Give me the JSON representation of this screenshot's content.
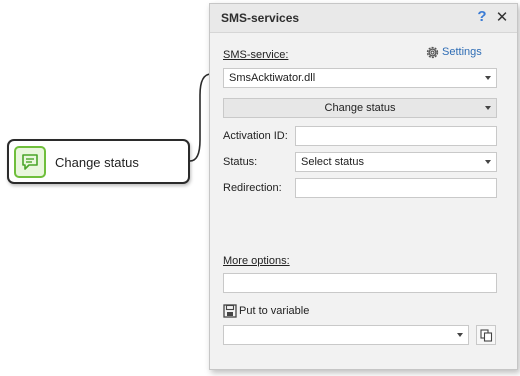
{
  "node": {
    "label": "Change status",
    "icon": "sms-message-icon",
    "accent": "#6fbf3b"
  },
  "dialog": {
    "title": "SMS-services",
    "help_icon": "question-icon",
    "help_glyph": "?",
    "close_icon": "close-icon",
    "close_glyph": "✕",
    "settings_label": "Settings",
    "service_label": "SMS-service:",
    "service_value": "SmsAcktiwator.dll",
    "action_value": "Change status",
    "activation_label": "Activation ID:",
    "activation_value": "",
    "status_label": "Status:",
    "status_value": "Select status",
    "redirection_label": "Redirection:",
    "redirection_value": "",
    "more_options_label": "More options:",
    "more_options_value": "",
    "put_to_variable_label": "Put to variable",
    "variable_value": "",
    "link_color": "#2f6db5"
  }
}
